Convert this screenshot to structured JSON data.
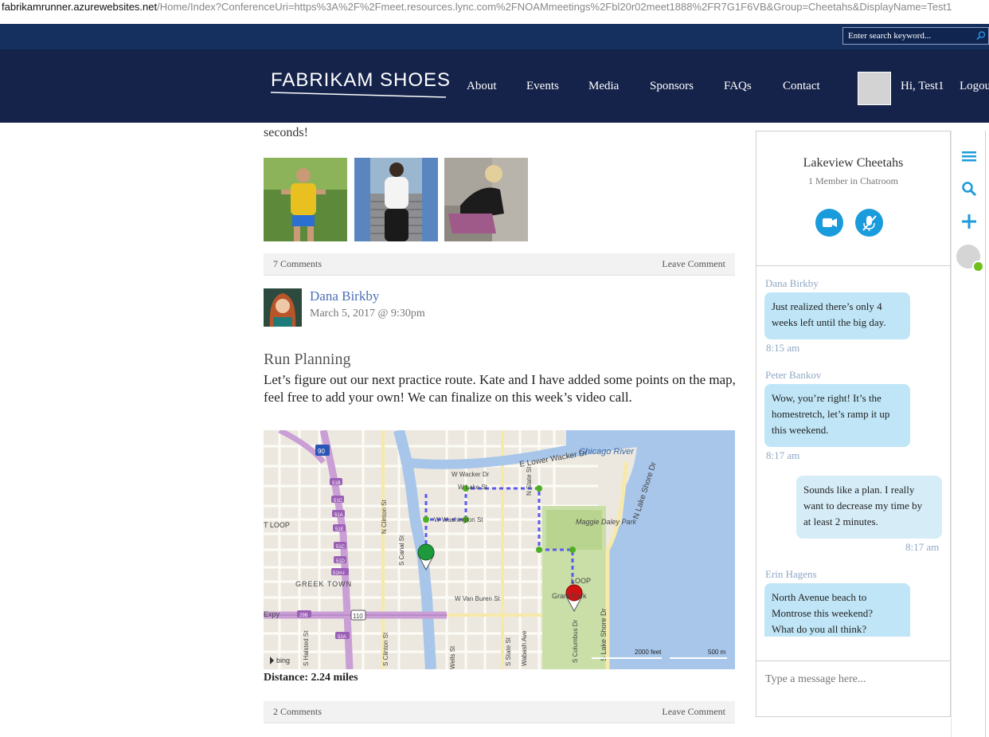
{
  "browser": {
    "url_host": "fabrikamrunner.azurewebsites.net",
    "url_path": "/Home/Index?ConferenceUri=https%3A%2F%2Fmeet.resources.lync.com%2FNOAMmeetings%2Fbl20r02meet1888%2FR7G1F6VB&Group=Cheetahs&DisplayName=Test1"
  },
  "header": {
    "search_placeholder": "Enter search keyword...",
    "logo_text": "FABRIKAM SHOES",
    "nav": [
      "About",
      "Events",
      "Media",
      "Sponsors",
      "FAQs",
      "Contact"
    ],
    "greeting": "Hi, Test1",
    "logout": "Logou"
  },
  "feed": {
    "prev_post_tail": "seconds!",
    "prev_comments": "7 Comments",
    "leave_comment": "Leave Comment",
    "post": {
      "author": "Dana Birkby",
      "date": "March 5, 2017 @ 9:30pm",
      "title": "Run Planning",
      "body": "Let’s figure out our next practice route. Kate and I have added some points on the map, feel free to add your own! We can finalize on this week’s video call.",
      "distance": "Distance: 2.24 miles",
      "comments": "2 Comments",
      "leave_comment": "Leave Comment"
    },
    "map_labels": {
      "river": "Chicago River",
      "wacker": "E Lower Wacker Dr",
      "w_wacker": "W Wacker Dr",
      "lake_st": "W Lake St",
      "washington": "W Washington St",
      "van_buren": "W Van Buren St",
      "millennium": "Maggie Daley Park",
      "lake_shore": "N Lake Shore Dr",
      "s_lake_shore": "S Lake Shore Dr",
      "loop": "LOOP",
      "t_loop": "T LOOP",
      "greektown": "GREEK TOWN",
      "grant_park": "Grant Park",
      "canal": "S Canal St",
      "clinton_n": "N Clinton St",
      "clinton_s": "S Clinton St",
      "state": "S State St",
      "columbus": "S Columbus Dr",
      "wabash": "Wabash Ave",
      "halsted": "S Halsted St",
      "n_state": "N State St",
      "wells": "Wells St",
      "expy": "Expy",
      "scale_feet": "2000 feet",
      "scale_m": "500 m",
      "bing": "bing",
      "i90": "90",
      "i290": "290",
      "r110": "110",
      "exits": [
        "51B",
        "51C",
        "51A",
        "51E",
        "51C",
        "51D",
        "51H-I",
        "29B",
        "52A"
      ]
    }
  },
  "chat": {
    "room": "Lakeview Cheetahs",
    "members": "1 Member in Chatroom",
    "messages": [
      {
        "sender": "Dana Birkby",
        "lines": [
          "Just realized there’s only 4",
          "weeks left until the big day."
        ],
        "time": "8:15 am"
      },
      {
        "sender": "Peter Bankov",
        "lines": [
          "Wow, you’re right! It’s the",
          "homestretch, let’s ramp it up",
          "this weekend."
        ],
        "time": "8:17 am"
      },
      {
        "sender": "",
        "lines": [
          "Sounds like a plan. I really",
          "want to decrease my time by",
          "at least 2 minutes."
        ],
        "time": "8:17 am"
      },
      {
        "sender": "Erin Hagens",
        "lines": [
          "North Avenue beach to",
          "Montrose this weekend?",
          "What do you all think?"
        ],
        "time": ""
      }
    ],
    "compose_placeholder": "Type a message here..."
  },
  "colors": {
    "navbar": "#15234a",
    "topstrip": "#15305e",
    "accent": "#1a9bdc",
    "bubble": "#bfe5f6",
    "presence": "#6fbf1f"
  }
}
